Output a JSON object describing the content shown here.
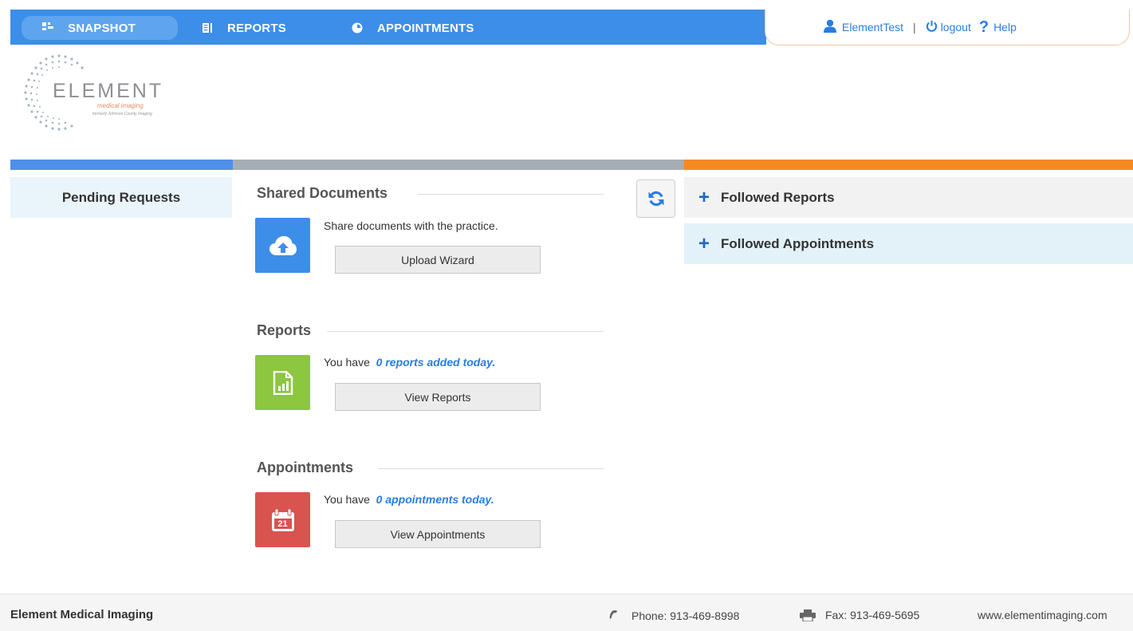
{
  "nav": {
    "items": [
      {
        "label": "SNAPSHOT",
        "icon": "dashboard-icon"
      },
      {
        "label": "REPORTS",
        "icon": "document-icon"
      },
      {
        "label": "APPOINTMENTS",
        "icon": "clock-icon"
      }
    ],
    "user": "ElementTest",
    "separator": "|",
    "logout": "logout",
    "help_mark": "?",
    "help": "Help"
  },
  "logo": {
    "title": "ELEMENT",
    "subtitle": "medical imaging",
    "small": "formerly Johnson County Imaging"
  },
  "left": {
    "pending_requests": "Pending Requests"
  },
  "shared_documents": {
    "title": "Shared Documents",
    "description": "Share documents with the practice.",
    "button": "Upload Wizard"
  },
  "reports": {
    "title": "Reports",
    "prefix": "You have",
    "highlight": "0 reports added today.",
    "button": "View Reports"
  },
  "appointments": {
    "title": "Appointments",
    "prefix": "You have",
    "highlight": "0 appointments today.",
    "button": "View Appointments",
    "calendar_day": "21"
  },
  "right": {
    "followed_reports": "Followed Reports",
    "followed_appointments": "Followed Appointments",
    "plus": "+"
  },
  "footer": {
    "name": "Element Medical Imaging",
    "phone": "Phone: 913-469-8998",
    "fax": "Fax: 913-469-5695",
    "website": "www.elementimaging.com"
  },
  "colors": {
    "nav_blue": "#3d8ee8",
    "bar_blue": "#4f8fea",
    "bar_grey": "#a6adb4",
    "bar_orange": "#f58a23",
    "upload_tile": "#3d8ee8",
    "reports_tile": "#8dc63f",
    "appointments_tile": "#d9534f",
    "link_blue": "#2a7de1"
  }
}
